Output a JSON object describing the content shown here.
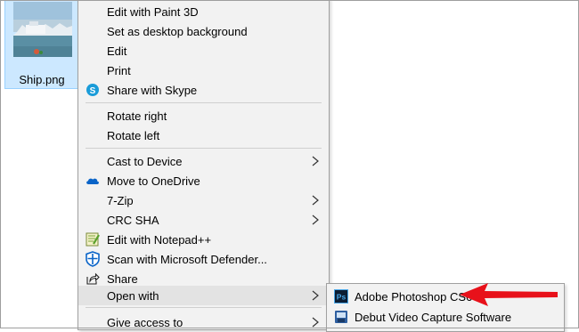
{
  "file": {
    "name": "Ship.png"
  },
  "menu": {
    "items": [
      {
        "label": "Edit with Paint 3D"
      },
      {
        "label": "Set as desktop background"
      },
      {
        "label": "Edit"
      },
      {
        "label": "Print"
      },
      {
        "label": "Share with Skype",
        "icon": "skype-icon"
      },
      {
        "label": "Rotate right"
      },
      {
        "label": "Rotate left"
      },
      {
        "label": "Cast to Device",
        "submenu": true
      },
      {
        "label": "Move to OneDrive",
        "icon": "onedrive-icon"
      },
      {
        "label": "7-Zip",
        "submenu": true
      },
      {
        "label": "CRC SHA",
        "submenu": true
      },
      {
        "label": "Edit with Notepad++",
        "icon": "notepadpp-icon"
      },
      {
        "label": "Scan with Microsoft Defender...",
        "icon": "defender-icon"
      },
      {
        "label": "Share",
        "icon": "share-icon"
      },
      {
        "label": "Open with",
        "submenu": true
      },
      {
        "label": "Give access to",
        "submenu": true
      }
    ]
  },
  "submenu": {
    "items": [
      {
        "label": "Adobe Photoshop CS6",
        "icon": "photoshop-icon"
      },
      {
        "label": "Debut Video Capture Software",
        "icon": "debut-icon"
      }
    ]
  },
  "colors": {
    "menu_bg": "#f2f2f2",
    "highlight": "#e3e3e3",
    "selection_tile": "#cce8ff",
    "arrow": "#e8111a",
    "skype": "#1a9cd9",
    "onedrive": "#0a64c8",
    "defender": "#0a64c8"
  }
}
